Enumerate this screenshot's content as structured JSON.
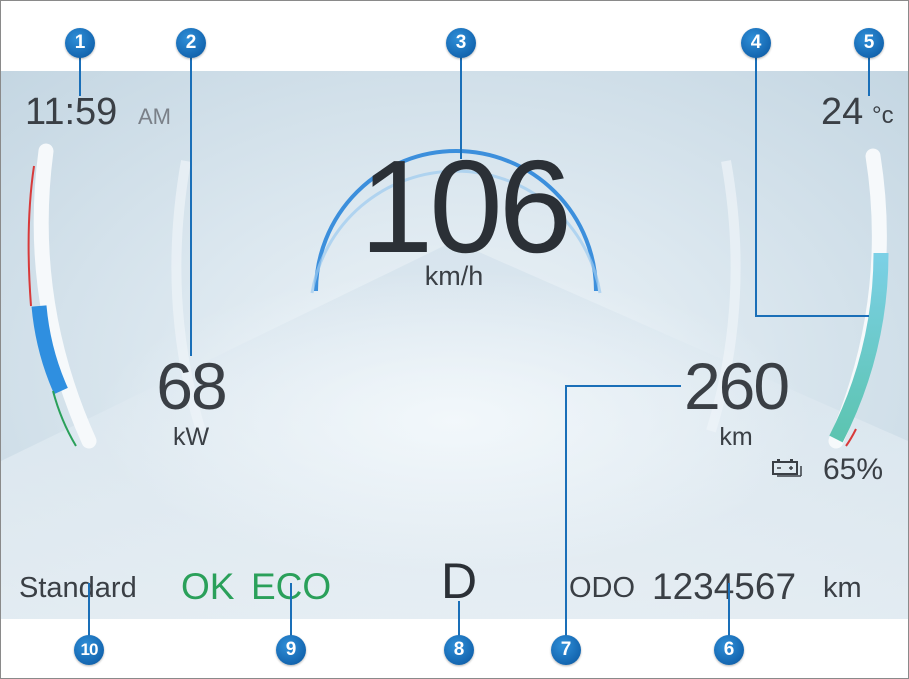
{
  "clock": {
    "time": "11:59",
    "ampm": "AM"
  },
  "temperature": {
    "value": "24",
    "unit": "°c"
  },
  "speed": {
    "value": "106",
    "unit": "km/h"
  },
  "power": {
    "value": "68",
    "unit": "kW"
  },
  "range": {
    "value": "260",
    "unit": "km"
  },
  "battery": {
    "percent_label": "65%",
    "level": 0.65,
    "icon": "battery-icon"
  },
  "drive_mode": "Standard",
  "ok_label": "OK",
  "eco_label": "ECO",
  "gear": "D",
  "odometer": {
    "label": "ODO",
    "value": "1234567",
    "unit": "km"
  },
  "callouts": [
    "1",
    "2",
    "3",
    "4",
    "5",
    "6",
    "7",
    "8",
    "9",
    "10"
  ],
  "colors": {
    "accent_green": "#2aa05a",
    "callout_blue": "#1a6fb8",
    "battery_teal": "#6cc8c8",
    "power_blue": "#2f8fe0"
  }
}
